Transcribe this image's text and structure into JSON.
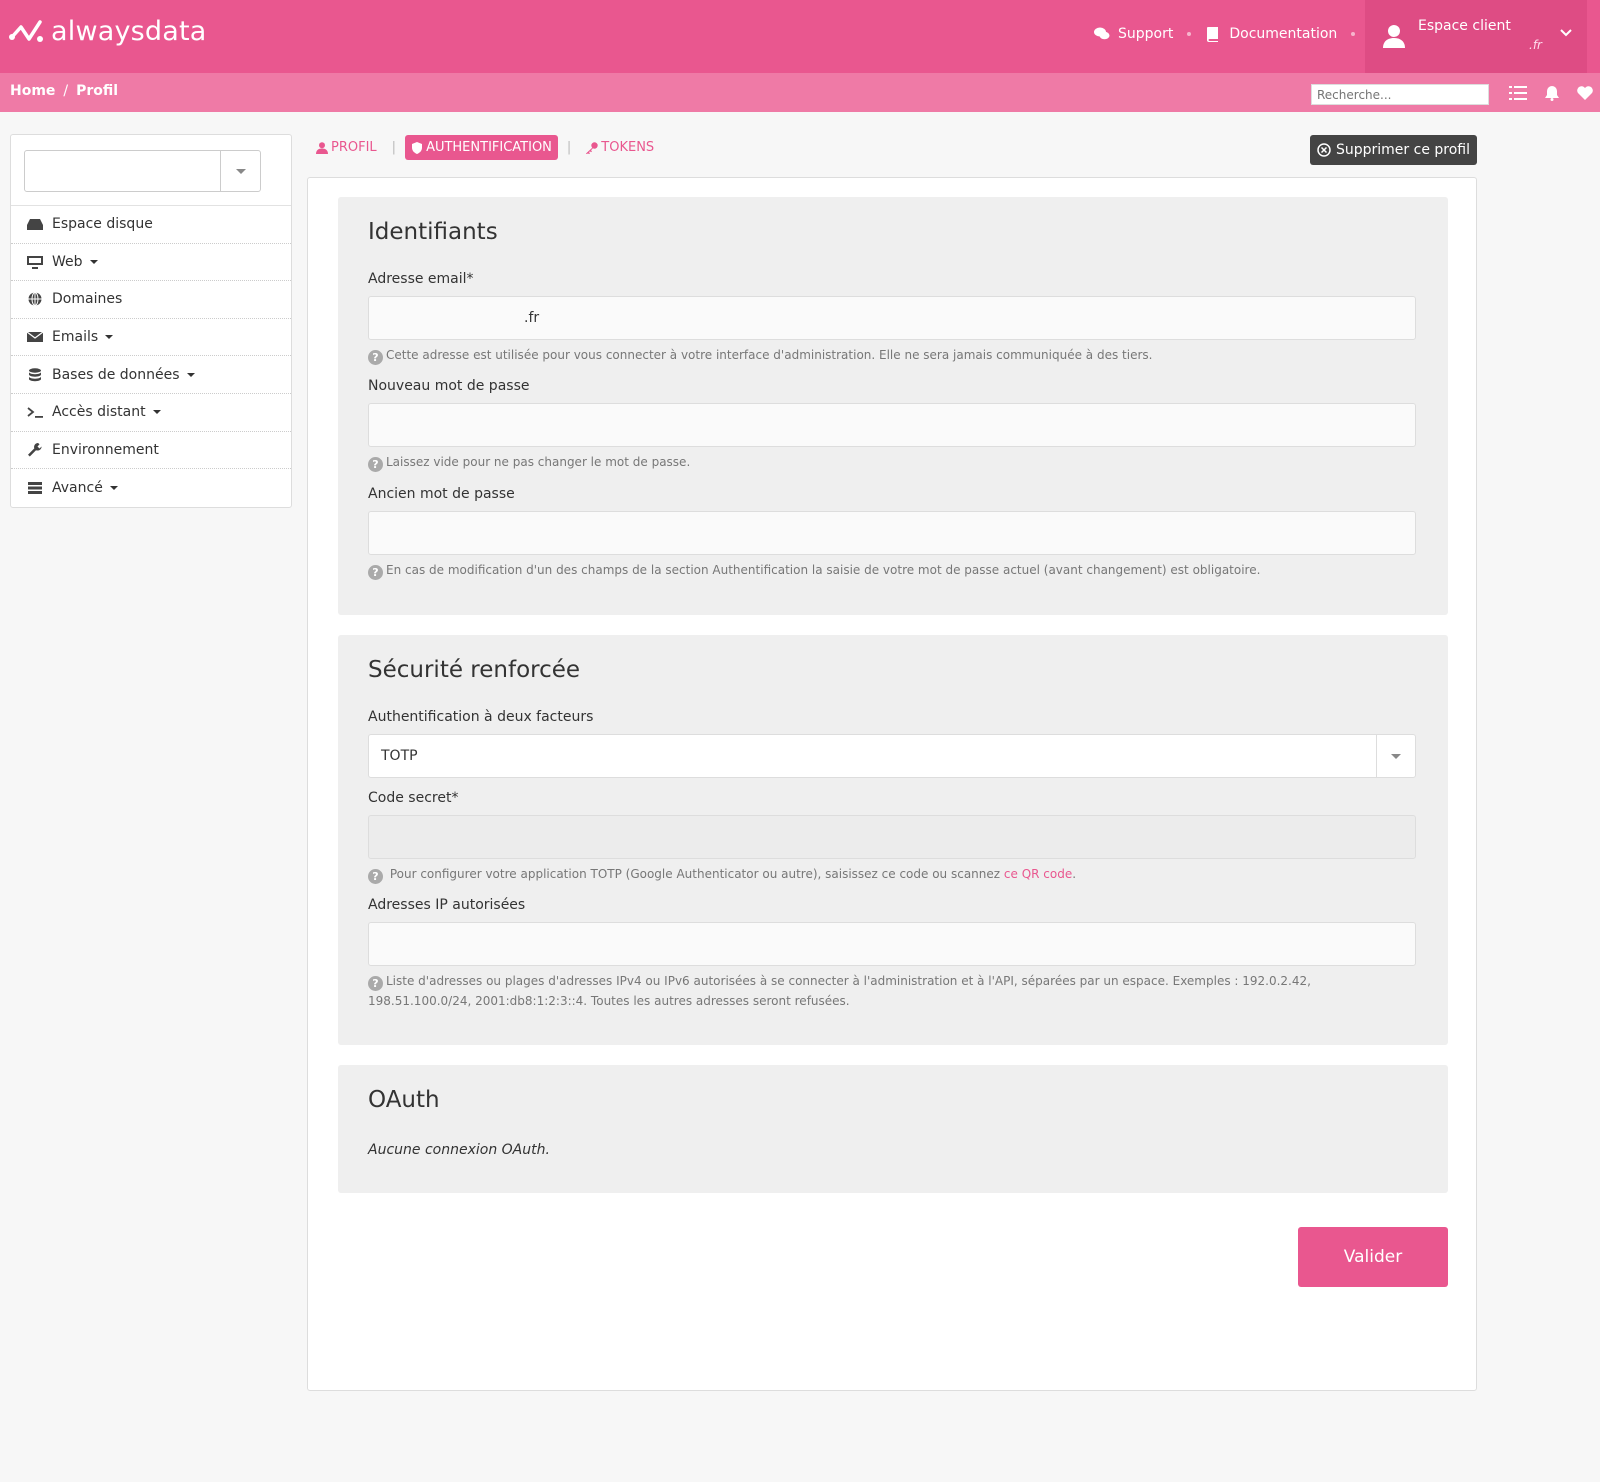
{
  "header": {
    "logo_text": "alwaysdata",
    "support_label": "Support",
    "docs_label": "Documentation",
    "account_label": "Espace client",
    "account_sub": ".fr"
  },
  "breadcrumb": {
    "home": "Home",
    "separator": "/",
    "current": "Profil"
  },
  "search": {
    "placeholder": "Recherche..."
  },
  "sidebar": {
    "items": [
      {
        "label": "Espace disque",
        "icon": "hdd-icon"
      },
      {
        "label": "Web",
        "icon": "monitor-icon"
      },
      {
        "label": "Domaines",
        "icon": "globe-icon"
      },
      {
        "label": "Emails",
        "icon": "envelope-icon"
      },
      {
        "label": "Bases de données",
        "icon": "database-icon"
      },
      {
        "label": "Accès distant",
        "icon": "terminal-icon"
      },
      {
        "label": "Environnement",
        "icon": "wrench-icon"
      },
      {
        "label": "Avancé",
        "icon": "server-icon"
      }
    ]
  },
  "tabs": {
    "profil": "PROFIL",
    "auth": "AUTHENTIFICATION",
    "tokens": "TOKENS",
    "separator": "|"
  },
  "delete_label": "Supprimer ce profil",
  "identifiants": {
    "title": "Identifiants",
    "email_label": "Adresse email*",
    "email_value": ".fr",
    "email_help": "Cette adresse est utilisée pour vous connecter à votre interface d'administration. Elle ne sera jamais communiquée à des tiers.",
    "new_pw_label": "Nouveau mot de passe",
    "new_pw_help": "Laissez vide pour ne pas changer le mot de passe.",
    "old_pw_label": "Ancien mot de passe",
    "old_pw_help": "En cas de modification d'un des champs de la section Authentification la saisie de votre mot de passe actuel (avant changement) est obligatoire."
  },
  "securite": {
    "title": "Sécurité renforcée",
    "twofa_label": "Authentification à deux facteurs",
    "twofa_value": "TOTP",
    "secret_label": "Code secret*",
    "secret_help": "Pour configurer votre application TOTP (Google Authenticator ou autre), saisissez ce code ou scannez",
    "secret_help_link": "ce QR code",
    "secret_help_end": ".",
    "ip_label": "Adresses IP autorisées",
    "ip_help": "Liste d'adresses ou plages d'adresses IPv4 ou IPv6 autorisées à se connecter à l'administration et à l'API, séparées par un espace. Exemples : 192.0.2.42, 198.51.100.0/24, 2001:db8:1:2:3::4. Toutes les autres adresses seront refusées."
  },
  "oauth": {
    "title": "OAuth",
    "empty": "Aucune connexion OAuth."
  },
  "submit_label": "Valider",
  "colors": {
    "brand": "#e9578f",
    "brand_light": "#ef7aa6",
    "dark_button": "#444444"
  }
}
